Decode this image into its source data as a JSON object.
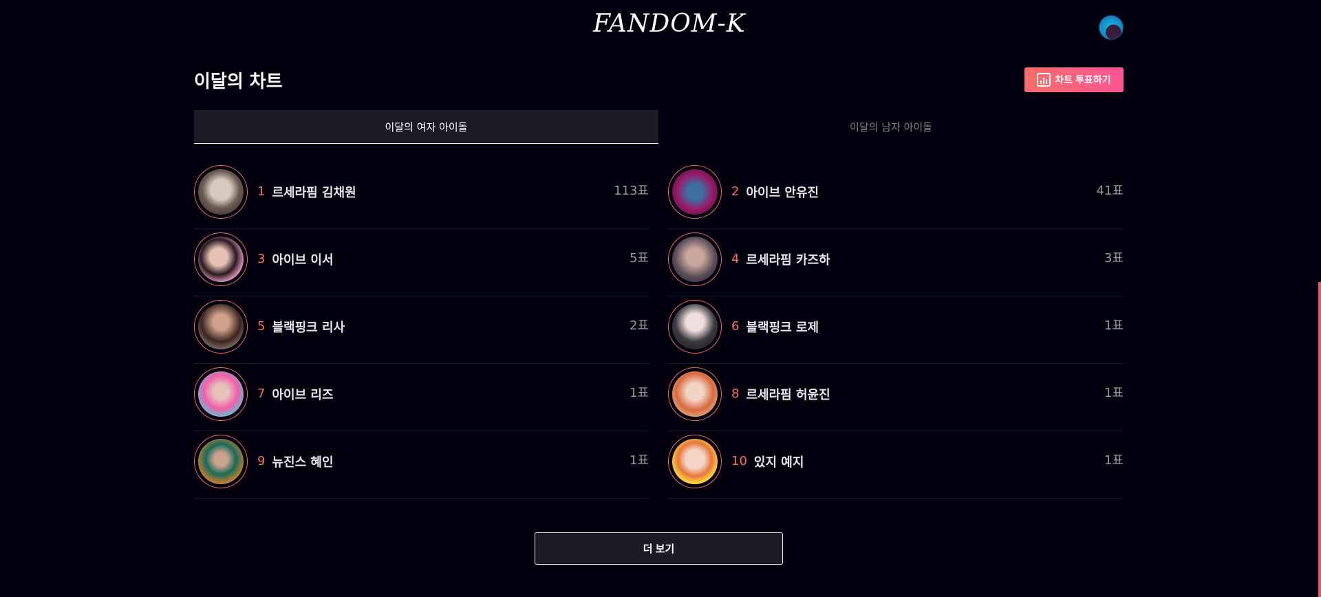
{
  "header": {
    "logo_text": "FANDOM-K",
    "avatar_icon": "profile-avatar"
  },
  "chart": {
    "title": "이달의 차트",
    "vote_button_label": "차트 투표하기",
    "vote_button_icon": "bar-chart-icon",
    "accent_color": "#f96d69",
    "tabs": [
      {
        "label": "이달의 여자 아이돌",
        "active": true
      },
      {
        "label": "이달의 남자 아이돌",
        "active": false
      }
    ],
    "left": [
      {
        "rank": "1",
        "name": "르세라핌 김채원",
        "votes": "113표"
      },
      {
        "rank": "3",
        "name": "아이브 이서",
        "votes": "5표"
      },
      {
        "rank": "5",
        "name": "블랙핑크 리사",
        "votes": "2표"
      },
      {
        "rank": "7",
        "name": "아이브 리즈",
        "votes": "1표"
      },
      {
        "rank": "9",
        "name": "뉴진스 혜인",
        "votes": "1표"
      }
    ],
    "right": [
      {
        "rank": "2",
        "name": "아이브 안유진",
        "votes": "41표"
      },
      {
        "rank": "4",
        "name": "르세라핌 카즈하",
        "votes": "3표"
      },
      {
        "rank": "6",
        "name": "블랙핑크 로제",
        "votes": "1표"
      },
      {
        "rank": "8",
        "name": "르세라핌 허윤진",
        "votes": "1표"
      },
      {
        "rank": "10",
        "name": "있지 예지",
        "votes": "1표"
      }
    ],
    "more_button_label": "더 보기"
  }
}
